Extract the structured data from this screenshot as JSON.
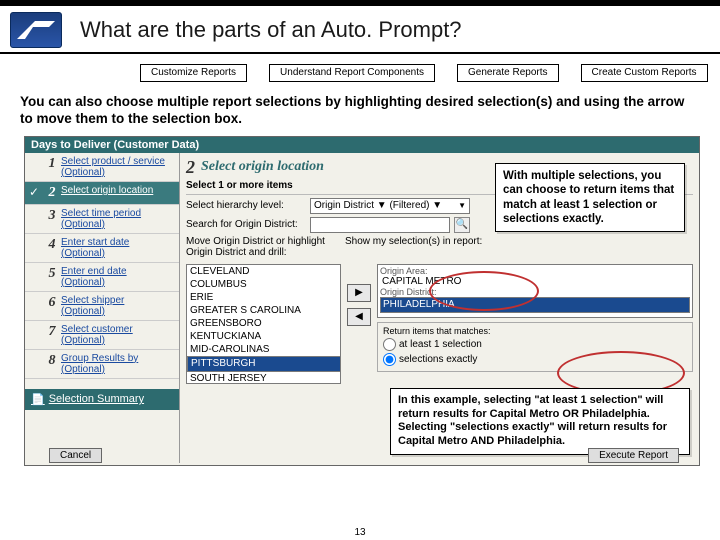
{
  "header": {
    "title": "What are the parts of an Auto. Prompt?"
  },
  "tabs": [
    "Customize Reports",
    "Understand Report Components",
    "Generate Reports",
    "Create Custom Reports"
  ],
  "intro": "You can also choose multiple report selections by highlighting desired selection(s) and using the arrow to move them to the selection box.",
  "app": {
    "title": "Days to Deliver (Customer Data)",
    "steps": [
      {
        "n": "1",
        "t": "Select product / service",
        "opt": "(Optional)"
      },
      {
        "n": "2",
        "t": "Select origin location",
        "active": true,
        "check": true
      },
      {
        "n": "3",
        "t": "Select time period",
        "opt": "(Optional)"
      },
      {
        "n": "4",
        "t": "Enter start date",
        "opt": "(Optional)"
      },
      {
        "n": "5",
        "t": "Enter end date",
        "opt": "(Optional)"
      },
      {
        "n": "6",
        "t": "Select shipper",
        "opt": "(Optional)"
      },
      {
        "n": "7",
        "t": "Select customer",
        "opt": "(Optional)"
      },
      {
        "n": "8",
        "t": "Group Results by",
        "opt": "(Optional)"
      }
    ],
    "summary": "Selection Summary",
    "main": {
      "heading_n": "2",
      "heading": "Select origin location",
      "sub": "Select 1 or more items",
      "hierarchy_label": "Select hierarchy level:",
      "hierarchy_value": "Origin District ▼ (Filtered) ▼",
      "search_label": "Search for Origin District:",
      "move_label": "Move Origin District or highlight Origin District and drill:",
      "list": [
        "CLEVELAND",
        "COLUMBUS",
        "ERIE",
        "GREATER S CAROLINA",
        "GREENSBORO",
        "KENTUCKIANA",
        "MID-CAROLINAS",
        "PITTSBURGH",
        "SOUTH JERSEY"
      ],
      "list_selected": "PITTSBURGH",
      "show_label": "Show my selection(s) in report:",
      "origin_area": "Origin Area:",
      "origin_area_val": "CAPITAL METRO",
      "origin_district": "Origin District:",
      "origin_district_val": "PHILADELPHIA",
      "match_label": "Return items that matches:",
      "match_opts": [
        "at least 1 selection",
        "selections exactly"
      ],
      "match_selected": 1
    },
    "cancel": "Cancel",
    "exec": "Execute Report"
  },
  "callouts": {
    "c1": "With multiple selections, you can choose to return items that match at least 1 selection or selections exactly.",
    "c2": "In this example, selecting \"at least 1 selection\" will return results for Capital Metro OR Philadelphia.  Selecting \"selections exactly\" will return results for Capital Metro AND Philadelphia."
  },
  "page": "13"
}
